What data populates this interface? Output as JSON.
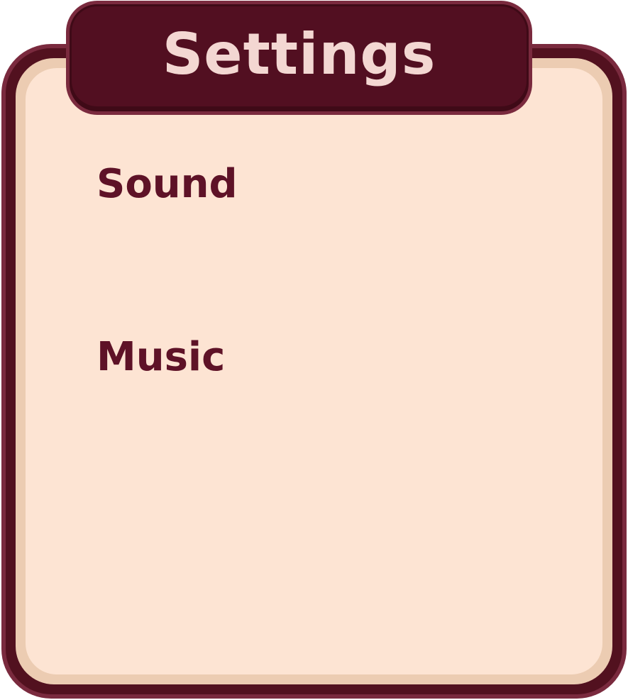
{
  "panel": {
    "title": "Settings",
    "options": [
      {
        "label": "Sound"
      },
      {
        "label": "Music"
      }
    ]
  },
  "colors": {
    "frame": "#7a2a3e",
    "frame_dark": "#52111f",
    "bezel": "#ecccb2",
    "body": "#fde4d3",
    "title_text": "#f3d7d2",
    "label_text": "#5e1227"
  }
}
